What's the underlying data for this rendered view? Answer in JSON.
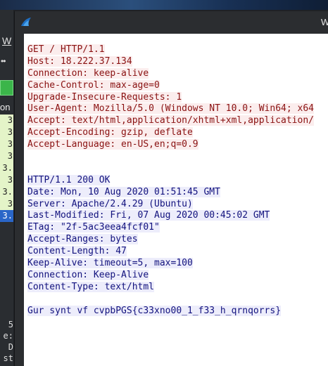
{
  "window": {
    "title": "W",
    "icon": "wireshark-fin-icon"
  },
  "left_panel": {
    "menu_label": "W",
    "toolbar_glyph": "••",
    "column_header": "on",
    "rows": [
      "3",
      "3",
      "3",
      "3",
      "3.",
      "3",
      "3.",
      "3",
      "3."
    ],
    "selected_row_index": 8,
    "detail_lines": [
      "5",
      "e:",
      "D",
      "st"
    ]
  },
  "stream": {
    "client_lines": [
      "GET / HTTP/1.1",
      "Host: 18.222.37.134",
      "Connection: keep-alive",
      "Cache-Control: max-age=0",
      "Upgrade-Insecure-Requests: 1",
      "User-Agent: Mozilla/5.0 (Windows NT 10.0; Win64; x64",
      "Accept: text/html,application/xhtml+xml,application/",
      "Accept-Encoding: gzip, deflate",
      "Accept-Language: en-US,en;q=0.9"
    ],
    "server_lines": [
      "HTTP/1.1 200 OK",
      "Date: Mon, 10 Aug 2020 01:51:45 GMT",
      "Server: Apache/2.4.29 (Ubuntu)",
      "Last-Modified: Fri, 07 Aug 2020 00:45:02 GMT",
      "ETag: \"2f-5ac3eea4fcf01\"",
      "Accept-Ranges: bytes",
      "Content-Length: 47",
      "Keep-Alive: timeout=5, max=100",
      "Connection: Keep-Alive",
      "Content-Type: text/html"
    ],
    "body_line": "Gur synt vf cvpbPGS{c33xno00_1_f33_h_qrnqorrs}",
    "colors": {
      "client_fg": "#8a1212",
      "client_bg": "#fbeded",
      "server_fg": "#12127e",
      "server_bg": "#ededfb"
    }
  }
}
